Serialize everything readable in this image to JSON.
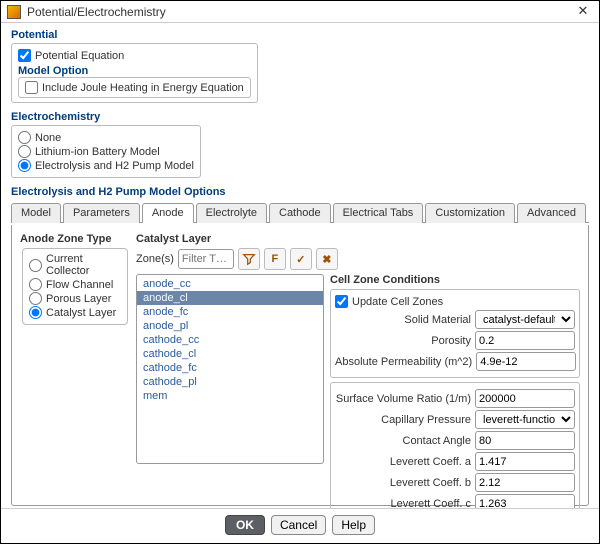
{
  "window": {
    "title": "Potential/Electrochemistry"
  },
  "potential": {
    "heading": "Potential",
    "eqn_label": "Potential Equation",
    "eqn_checked": true,
    "model_option_heading": "Model Option",
    "joule_label": "Include Joule Heating in Energy Equation",
    "joule_checked": false
  },
  "electrochem": {
    "heading": "Electrochemistry",
    "options": [
      {
        "label": "None",
        "checked": false
      },
      {
        "label": "Lithium-ion Battery Model",
        "checked": false
      },
      {
        "label": "Electrolysis and H2 Pump Model",
        "checked": true
      }
    ]
  },
  "eopts": {
    "heading": "Electrolysis and H2 Pump Model Options",
    "tabs": [
      "Model",
      "Parameters",
      "Anode",
      "Electrolyte",
      "Cathode",
      "Electrical Tabs",
      "Customization",
      "Advanced"
    ],
    "active_tab": "Anode"
  },
  "anode_zone_type": {
    "heading": "Anode Zone Type",
    "options": [
      {
        "label": "Current Collector",
        "checked": false
      },
      {
        "label": "Flow Channel",
        "checked": false
      },
      {
        "label": "Porous Layer",
        "checked": false
      },
      {
        "label": "Catalyst Layer",
        "checked": true
      }
    ]
  },
  "catalyst": {
    "heading": "Catalyst Layer",
    "zone_label": "Zone(s)",
    "filter_placeholder": "Filter T…",
    "zones": [
      "anode_cc",
      "anode_cl",
      "anode_fc",
      "anode_pl",
      "cathode_cc",
      "cathode_cl",
      "cathode_fc",
      "cathode_pl",
      "mem"
    ],
    "selected": "anode_cl"
  },
  "cellzone": {
    "heading": "Cell Zone Conditions",
    "update_label": "Update Cell Zones",
    "update_checked": true,
    "solid_material_label": "Solid Material",
    "solid_material_value": "catalyst-default",
    "porosity_label": "Porosity",
    "porosity_value": "0.2",
    "abs_perm_label": "Absolute Permeability (m^2)",
    "abs_perm_value": "4.9e-12",
    "svr_label": "Surface Volume Ratio (1/m)",
    "svr_value": "200000",
    "capillary_label": "Capillary Pressure",
    "capillary_value": "leverett-function",
    "contact_angle_label": "Contact Angle",
    "contact_angle_value": "80",
    "lev_a_label": "Leverett Coeff. a",
    "lev_a_value": "1.417",
    "lev_b_label": "Leverett Coeff. b",
    "lev_b_value": "2.12",
    "lev_c_label": "Leverett Coeff. c",
    "lev_c_value": "1.263"
  },
  "footer": {
    "ok": "OK",
    "cancel": "Cancel",
    "help": "Help"
  }
}
